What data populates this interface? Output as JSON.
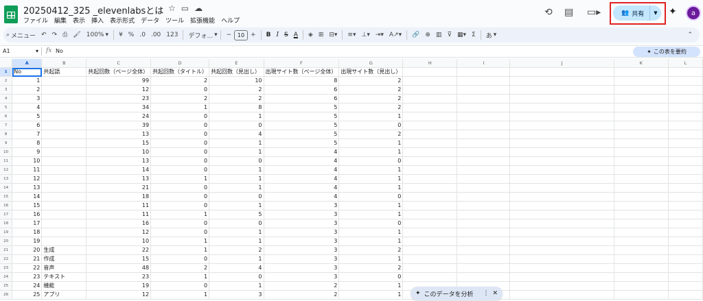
{
  "app": {
    "doc_title": "20250412_325 _elevenlabsとは",
    "menu": [
      "ファイル",
      "編集",
      "表示",
      "挿入",
      "表示形式",
      "データ",
      "ツール",
      "拡張機能",
      "ヘルプ"
    ],
    "share_label": "共有",
    "avatar_letter": "a"
  },
  "toolbar": {
    "menu_search": "メニュー",
    "zoom": "100%",
    "currency": "¥",
    "percent": "%",
    "dec_decrease": ".0",
    "dec_increase": ".00",
    "number_format": "123",
    "font": "デフォ...",
    "font_size": "10",
    "input_mode": "あ"
  },
  "formula_bar": {
    "cell_ref": "A1",
    "fx": "fx",
    "value": "No",
    "summarize_label": "この表を要約"
  },
  "sheet": {
    "columns": [
      "A",
      "B",
      "C",
      "D",
      "E",
      "F",
      "G",
      "H",
      "I",
      "J",
      "K",
      "L"
    ],
    "header_row": [
      "No",
      "共起語",
      "共起回数（ページ全体）",
      "共起回数（タイトル）",
      "共起回数（見出し）",
      "出現サイト数（ページ全体）",
      "出現サイト数（見出し）"
    ],
    "rows": [
      [
        1,
        "",
        99,
        2,
        10,
        8,
        2
      ],
      [
        2,
        "",
        12,
        0,
        2,
        6,
        2
      ],
      [
        3,
        "",
        23,
        2,
        2,
        6,
        2
      ],
      [
        4,
        "",
        34,
        1,
        8,
        5,
        2
      ],
      [
        5,
        "",
        24,
        0,
        1,
        5,
        1
      ],
      [
        6,
        "",
        39,
        0,
        0,
        5,
        0
      ],
      [
        7,
        "",
        13,
        0,
        4,
        5,
        2
      ],
      [
        8,
        "",
        15,
        0,
        1,
        5,
        1
      ],
      [
        9,
        "",
        10,
        0,
        1,
        4,
        1
      ],
      [
        10,
        "",
        13,
        0,
        0,
        4,
        0
      ],
      [
        11,
        "",
        14,
        0,
        1,
        4,
        1
      ],
      [
        12,
        "",
        13,
        1,
        1,
        4,
        1
      ],
      [
        13,
        "",
        21,
        0,
        1,
        4,
        1
      ],
      [
        14,
        "",
        18,
        0,
        0,
        4,
        0
      ],
      [
        15,
        "",
        11,
        0,
        1,
        3,
        1
      ],
      [
        16,
        "",
        11,
        1,
        5,
        3,
        1
      ],
      [
        17,
        "",
        16,
        0,
        0,
        3,
        0
      ],
      [
        18,
        "",
        12,
        0,
        1,
        3,
        1
      ],
      [
        19,
        "",
        10,
        1,
        1,
        3,
        1
      ],
      [
        20,
        "生成",
        22,
        1,
        2,
        3,
        2
      ],
      [
        21,
        "作成",
        15,
        0,
        1,
        3,
        1
      ],
      [
        22,
        "音声",
        48,
        2,
        4,
        3,
        2
      ],
      [
        23,
        "テキスト",
        23,
        1,
        0,
        3,
        0
      ],
      [
        24,
        "機能",
        19,
        0,
        1,
        2,
        1
      ],
      [
        25,
        "アプリ",
        12,
        1,
        3,
        2,
        1
      ]
    ]
  },
  "analyze": {
    "label": "このデータを分析"
  },
  "colors": {
    "accent": "#0b57d0",
    "share_bg": "#c2e7ff",
    "highlight_border": "#e02020",
    "sheets_green": "#0f9d58"
  }
}
